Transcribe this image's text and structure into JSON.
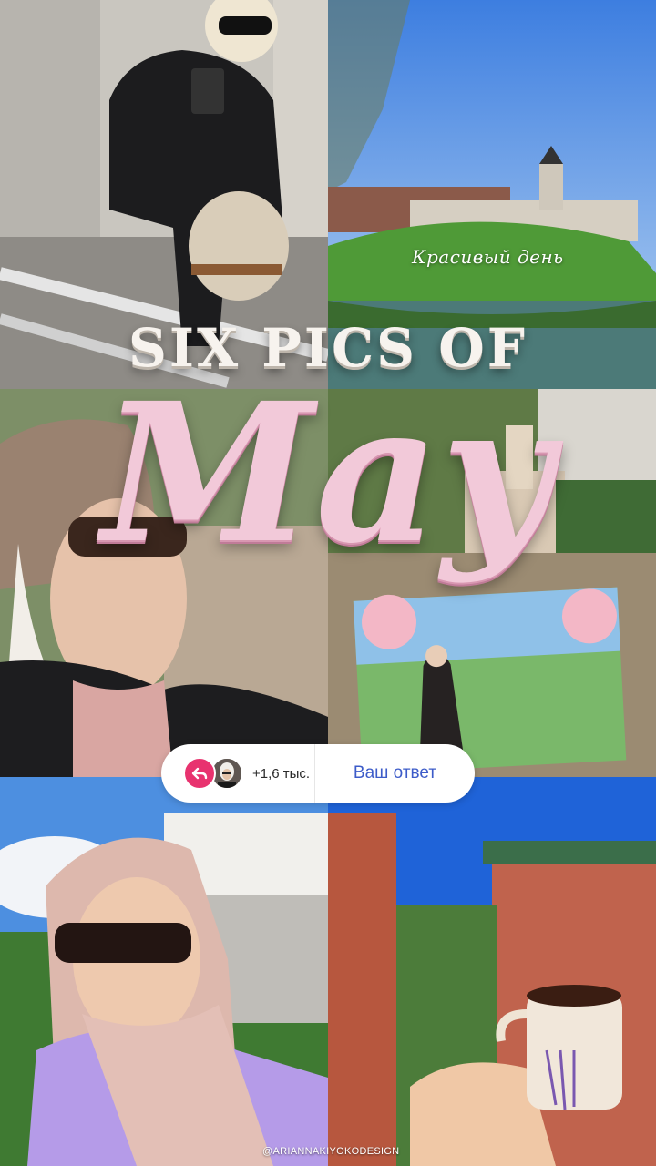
{
  "story": {
    "title_line1": "SIX PICS OF",
    "title_line2": "May",
    "caption": "Красивый день",
    "watermark": "@ARIANNAKIYOKODESIGN"
  },
  "reply_sticker": {
    "count_label": "+1,6 тыс.",
    "button_label": "Ваш ответ",
    "accent_color": "#e8336f",
    "button_color": "#3d5cc9"
  },
  "photos": [
    {
      "name": "elevator-mirror-selfie"
    },
    {
      "name": "castle-on-hill"
    },
    {
      "name": "beanie-selfie"
    },
    {
      "name": "church-and-postcard"
    },
    {
      "name": "headscarf-selfie"
    },
    {
      "name": "coffee-cup-city-view"
    }
  ]
}
